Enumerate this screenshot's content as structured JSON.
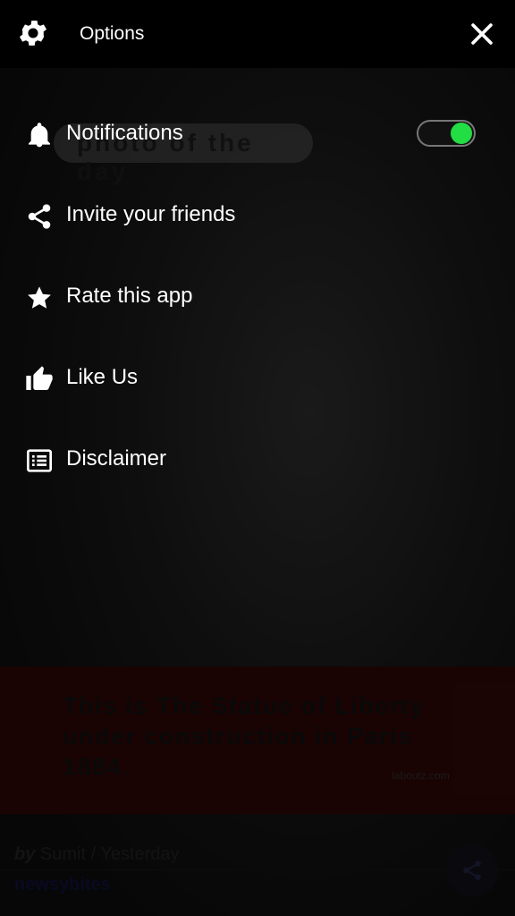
{
  "header": {
    "title": "Options"
  },
  "menu": {
    "items": [
      {
        "label": "Notifications",
        "icon": "bell-icon"
      },
      {
        "label": "Invite your friends",
        "icon": "share-icon"
      },
      {
        "label": "Rate this app",
        "icon": "star-icon"
      },
      {
        "label": "Like Us",
        "icon": "thumbs-up-icon"
      },
      {
        "label": "Disclaimer",
        "icon": "list-icon"
      }
    ],
    "notifications_enabled": true
  },
  "background_card": {
    "ribbon": "photo of the day",
    "caption": "This is The Statue of Liberty under construction in Paris 1884.",
    "credit": "laboutz.com",
    "byline_prefix": "by",
    "byline": "Sumit / Yesterday",
    "source": "newsybites"
  },
  "colors": {
    "toggle_on": "#22dd44",
    "accent_red": "#3a0808"
  }
}
